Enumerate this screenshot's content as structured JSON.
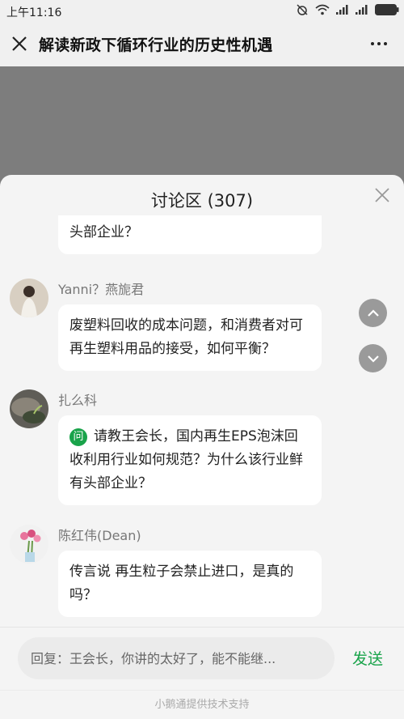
{
  "status_bar": {
    "time": "上午11:16",
    "icons": [
      "alarm-off-icon",
      "wifi-icon",
      "signal-icon",
      "signal-icon",
      "battery-icon"
    ]
  },
  "header": {
    "title": "解读新政下循环行业的历史性机遇",
    "close_icon": "close-icon",
    "more_icon": "more-icon"
  },
  "discussion": {
    "title": "讨论区 (307)",
    "close_icon": "close-icon",
    "messages": [
      {
        "sender": "",
        "text": "利用行业如何规范？为什么该行业鲜有头部企业？",
        "partial": true
      },
      {
        "sender": "Yanni？燕旎君",
        "text": "废塑料回收的成本问题，和消费者对可再生塑料用品的接受，如何平衡？"
      },
      {
        "sender": "扎么科",
        "badge": "问",
        "text": "请教王会长，国内再生EPS泡沫回收利用行业如何规范？为什么该行业鲜有头部企业？"
      },
      {
        "sender": "陈红伟(Dean)",
        "text": "传言说 再生粒子会禁止进口，是真的吗？"
      }
    ],
    "scroll_up_icon": "chevron-up-icon",
    "scroll_down_icon": "chevron-down-icon"
  },
  "reply": {
    "placeholder": "回复：王会长，你讲的太好了，能不能继...",
    "send_label": "发送"
  },
  "footer": {
    "text": "小鹅通提供技术支持"
  },
  "colors": {
    "accent": "#19a34a",
    "backdrop": "#7d7d7d"
  }
}
